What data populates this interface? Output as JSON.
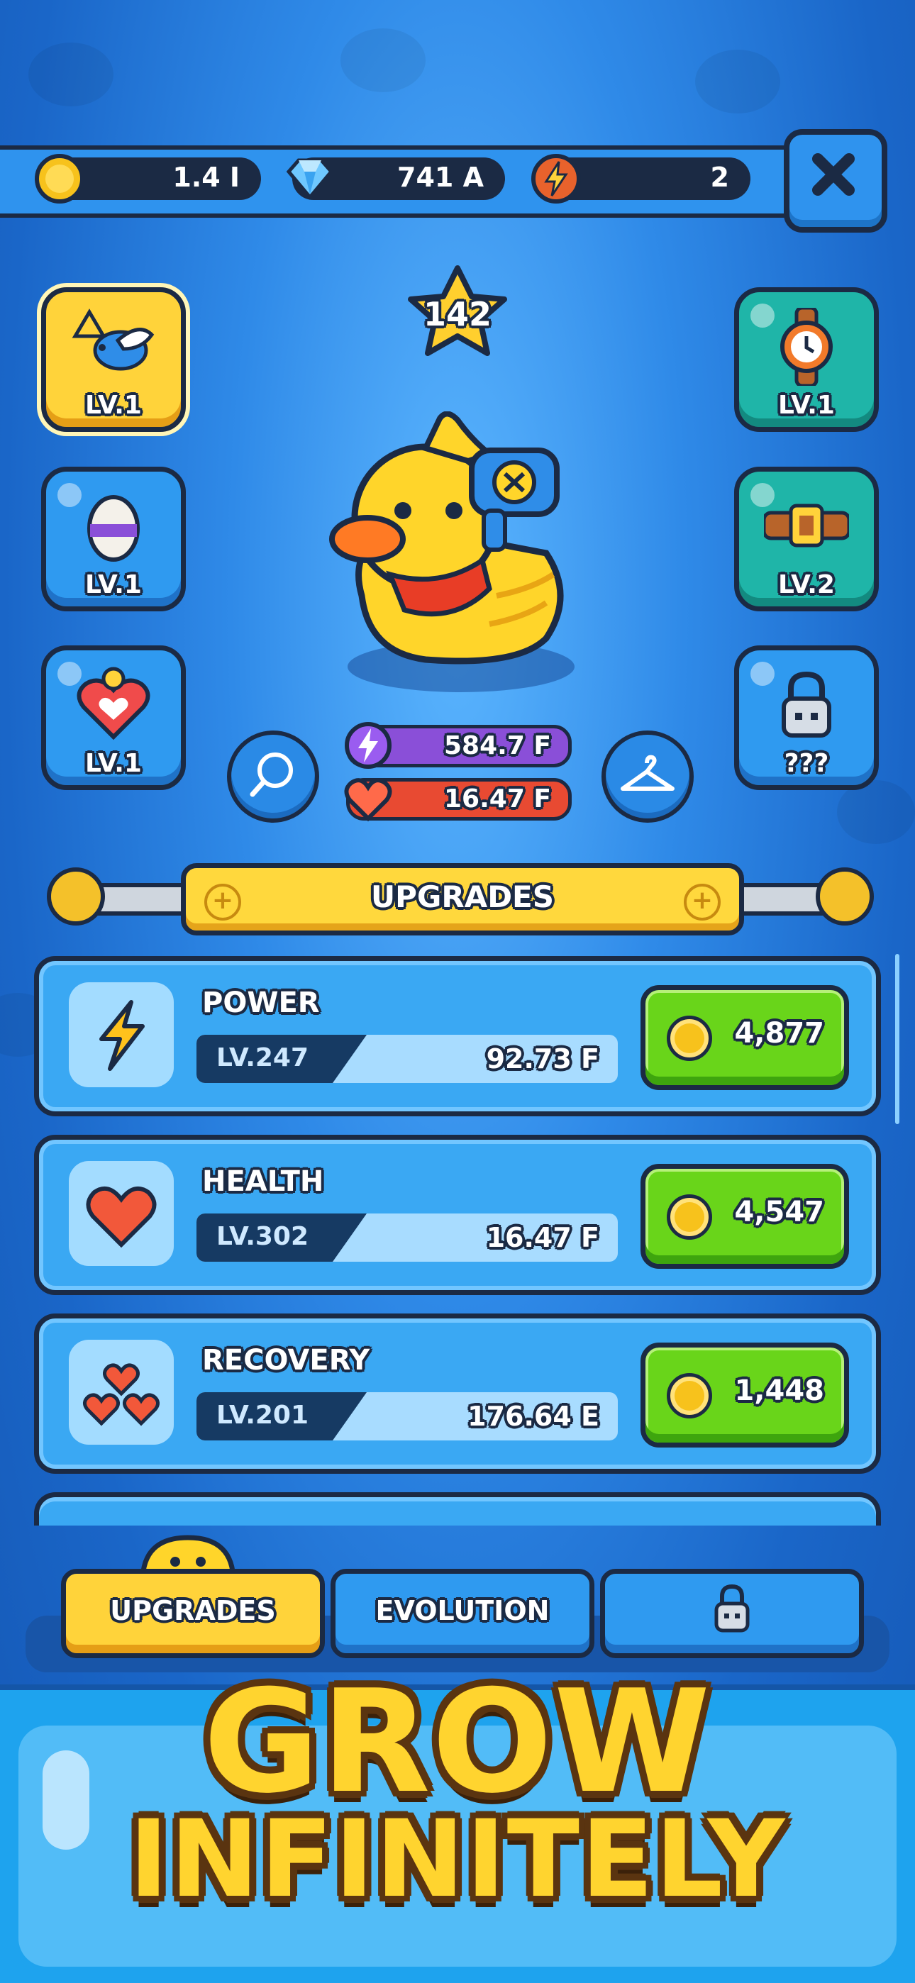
{
  "currencies": [
    {
      "name": "coin-icon",
      "value": "1.4 I"
    },
    {
      "name": "gem-icon",
      "value": "741 A"
    },
    {
      "name": "energy-icon",
      "value": "2"
    }
  ],
  "close_icon": "close-icon",
  "player": {
    "level": "142",
    "power": "584.7 F",
    "health": "16.47 F"
  },
  "slots": {
    "left": [
      {
        "icon": "bird-icon",
        "level": "LV.1",
        "style": "yellow"
      },
      {
        "icon": "egg-icon",
        "level": "LV.1",
        "style": "blue"
      },
      {
        "icon": "heart-chick-icon",
        "level": "LV.1",
        "style": "blue"
      }
    ],
    "right": [
      {
        "icon": "watch-icon",
        "level": "LV.1",
        "style": "teal"
      },
      {
        "icon": "belt-icon",
        "level": "LV.2",
        "style": "teal"
      },
      {
        "icon": "lock-icon",
        "level": "???",
        "style": "blue"
      }
    ]
  },
  "section_title": "UPGRADES",
  "upgrades": [
    {
      "name": "POWER",
      "level": "LV.247",
      "amount": "92.73 F",
      "price": "4,877",
      "icon": "lightning-icon"
    },
    {
      "name": "HEALTH",
      "level": "LV.302",
      "amount": "16.47 F",
      "price": "4,547",
      "icon": "heart-icon"
    },
    {
      "name": "RECOVERY",
      "level": "LV.201",
      "amount": "176.64 E",
      "price": "1,448",
      "icon": "hearts-icon"
    }
  ],
  "tabs": {
    "upgrades": "UPGRADES",
    "evolution": "EVOLUTION"
  },
  "promo": {
    "line1": "GROW",
    "line2": "INFINITELY"
  },
  "colors": {
    "accent_yellow": "#ffd33a",
    "buy_green": "#69d51a",
    "outline": "#1b2a44"
  }
}
